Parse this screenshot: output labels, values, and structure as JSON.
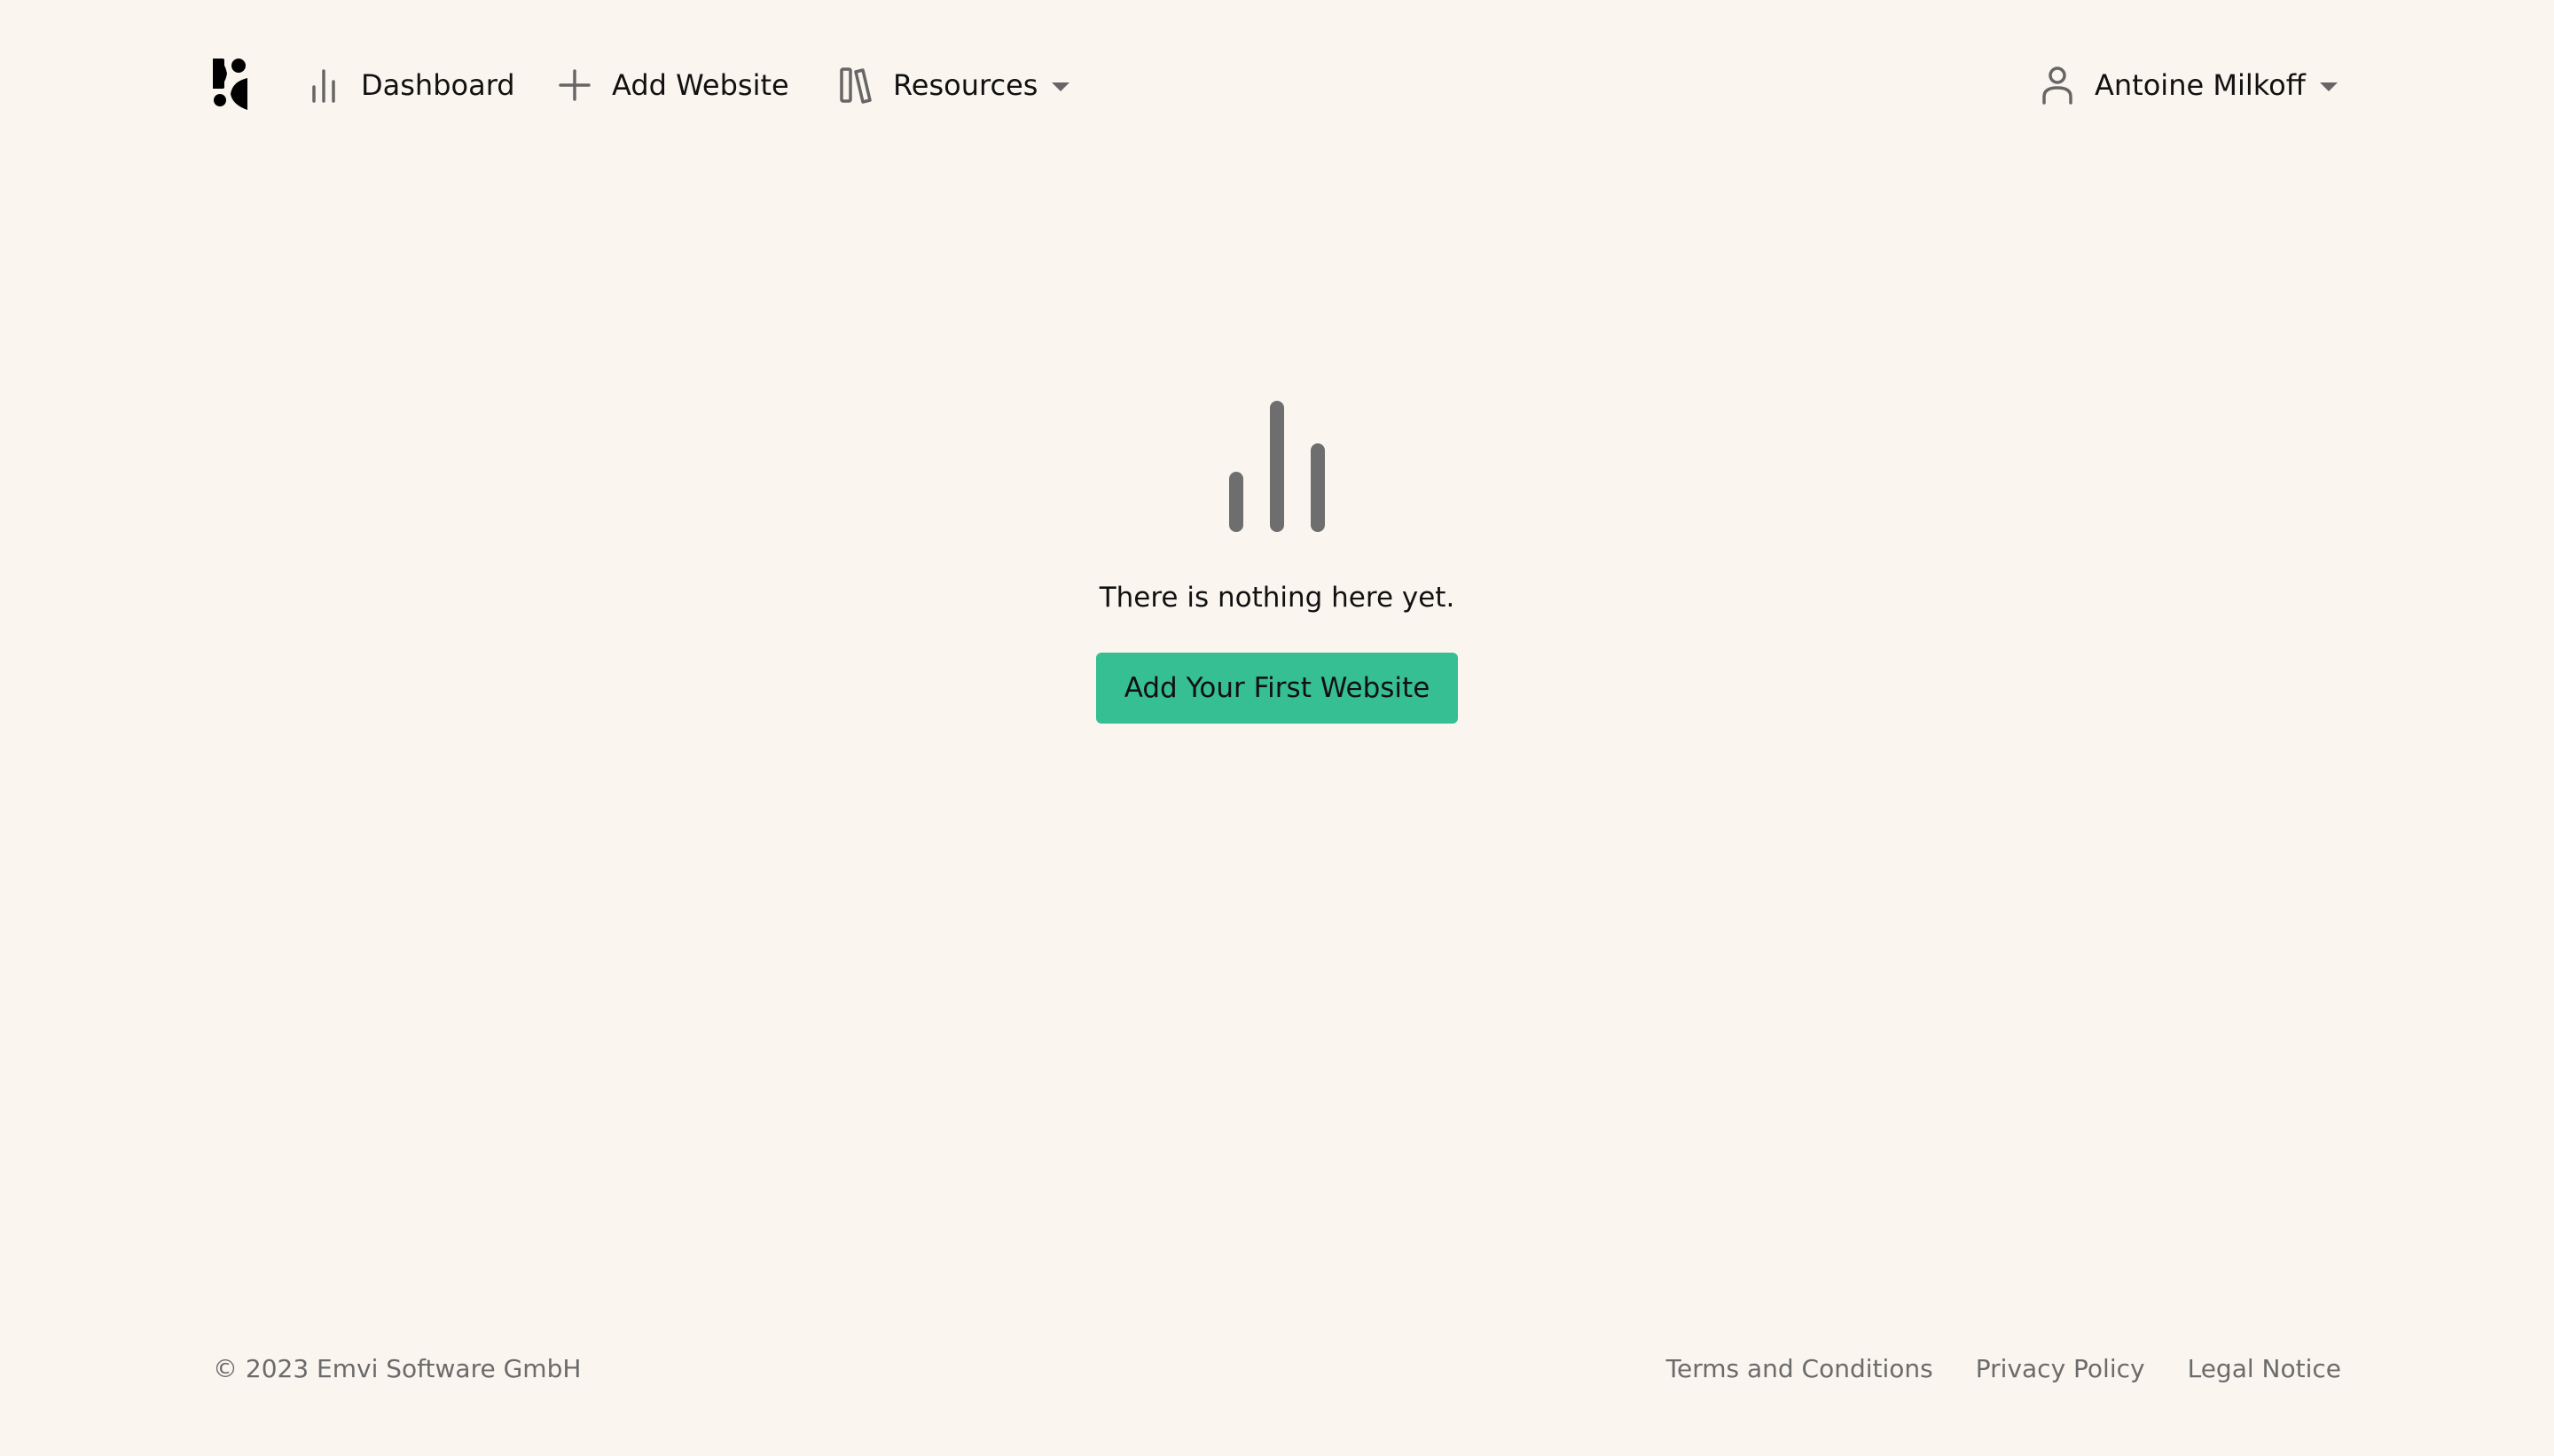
{
  "nav": {
    "logo_icon": "logo-icon",
    "dashboard_label": "Dashboard",
    "dashboard_icon": "bar-chart-icon",
    "add_website_label": "Add Website",
    "add_website_icon": "plus-icon",
    "resources_label": "Resources",
    "resources_icon": "books-icon",
    "user_name": "Antoine Milkoff",
    "user_icon": "user-icon"
  },
  "main": {
    "empty_icon": "bar-chart-icon",
    "empty_message": "There is nothing here yet.",
    "cta_label": "Add Your First Website"
  },
  "footer": {
    "copyright": "© 2023 Emvi Software GmbH",
    "links": [
      "Terms and Conditions",
      "Privacy Policy",
      "Legal Notice"
    ]
  },
  "colors": {
    "background": "#fbf5f0",
    "accent": "#36bf93",
    "text": "#111111",
    "muted": "#6b6b6b"
  }
}
